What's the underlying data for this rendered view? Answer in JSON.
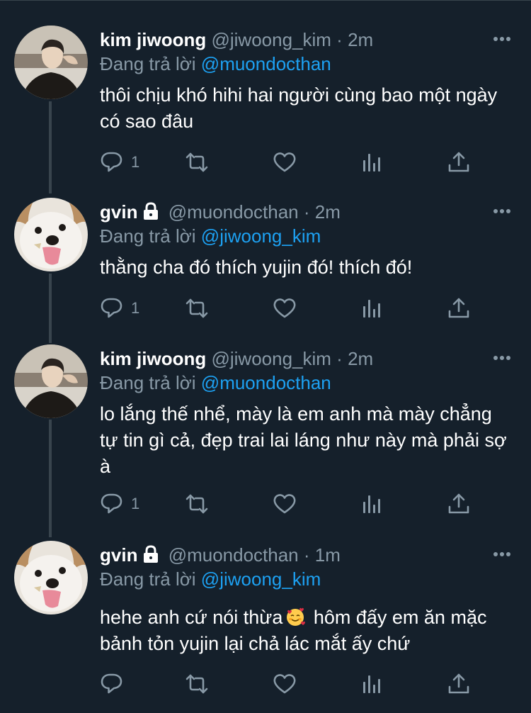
{
  "colors": {
    "background": "#15202b",
    "secondary_text": "#8899a6",
    "accent_link": "#1da1f2",
    "divider": "#38444d"
  },
  "tweets": [
    {
      "name": "kim jiwoong",
      "handle": "@jiwoong_kim",
      "dot": "·",
      "time": "2m",
      "reply_prefix": "Đang trả lời",
      "reply_to": "@muondocthan",
      "text": "thôi chịu khó hihi hai người cùng bao một ngày có sao đâu",
      "reply_count": "1",
      "avatar": "person-photo-avatar",
      "locked": false
    },
    {
      "name": "gvin",
      "handle": "@muondocthan",
      "dot": "·",
      "time": "2m",
      "reply_prefix": "Đang trả lời",
      "reply_to": "@jiwoong_kim",
      "text": "thằng cha đó thích yujin đó! thích đó!",
      "reply_count": "1",
      "avatar": "dog-photo-avatar",
      "locked": true
    },
    {
      "name": "kim jiwoong",
      "handle": "@jiwoong_kim",
      "dot": "·",
      "time": "2m",
      "reply_prefix": "Đang trả lời",
      "reply_to": "@muondocthan",
      "text": "lo lắng thế nhể, mày là em anh mà mày chẳng tự tin gì cả, đẹp trai lai láng như này mà phải sợ à",
      "reply_count": "1",
      "avatar": "person-photo-avatar",
      "locked": false
    },
    {
      "name": "gvin",
      "handle": "@muondocthan",
      "dot": "·",
      "time": "1m",
      "reply_prefix": "Đang trả lời",
      "reply_to": "@jiwoong_kim",
      "text_before_emoji": "hehe anh cứ nói thừa",
      "emoji": "smiling-face-with-hearts",
      "text_after_emoji": " hôm đấy em ăn mặc bảnh tỏn yujin lại chả lác mắt ấy chứ",
      "reply_count": "",
      "avatar": "dog-photo-avatar",
      "locked": true
    }
  ],
  "icons": {
    "reply": "reply-icon",
    "retweet": "retweet-icon",
    "like": "heart-icon",
    "analytics": "analytics-icon",
    "share": "share-icon",
    "more": "more-icon",
    "lock": "lock-icon"
  }
}
